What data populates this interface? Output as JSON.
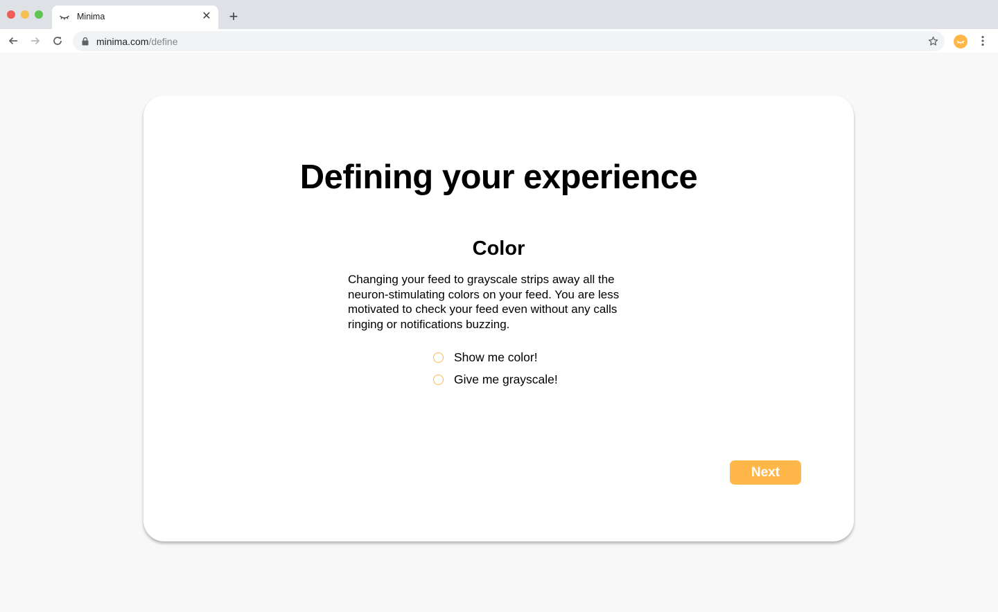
{
  "browser": {
    "tab": {
      "title": "Minima",
      "favicon": "minima-closed-eye-icon",
      "close_icon": "close-icon"
    },
    "new_tab_icon": "plus-icon",
    "nav": {
      "back_icon": "arrow-back-icon",
      "forward_icon": "arrow-forward-icon",
      "reload_icon": "reload-icon"
    },
    "address": {
      "domain": "minima.com",
      "path": "/define",
      "lock_icon": "lock-icon"
    },
    "bookmark_icon": "star-icon",
    "extension_icon": "minima-extension-icon",
    "menu_icon": "kebab-menu-icon"
  },
  "page": {
    "title": "Defining your experience",
    "section": {
      "title": "Color",
      "description": "Changing your feed to grayscale strips away all the neuron-stimulating colors on your feed. You are less motivated to check your feed even without any calls ringing or notifications buzzing.",
      "options": [
        {
          "label": "Show me color!",
          "selected": false
        },
        {
          "label": "Give me grayscale!",
          "selected": false
        }
      ]
    },
    "next_label": "Next"
  },
  "colors": {
    "accent": "#ffb74a",
    "background": "#f8f8f8",
    "card": "#ffffff",
    "text": "#000000"
  }
}
